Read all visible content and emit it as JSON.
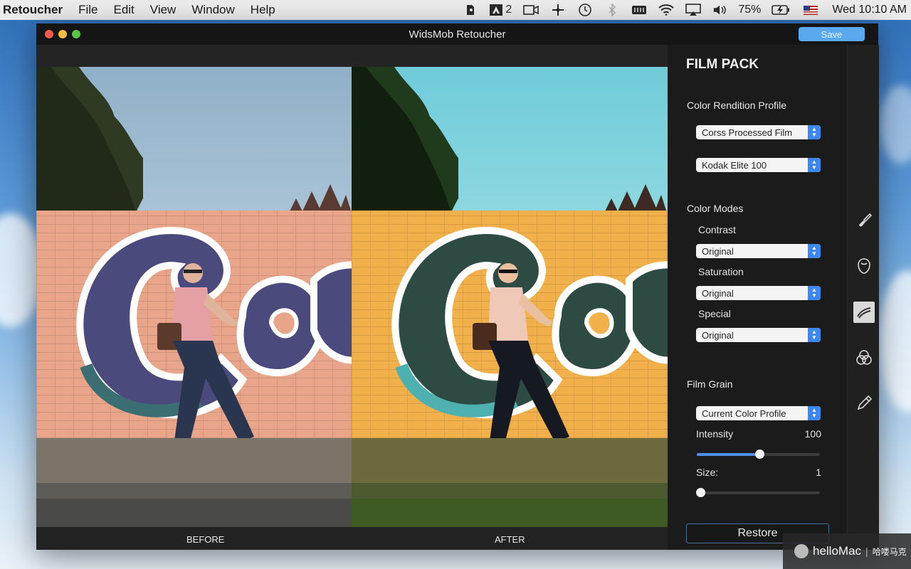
{
  "menubar": {
    "app_name": "Retoucher",
    "items": [
      "File",
      "Edit",
      "View",
      "Window",
      "Help"
    ],
    "adobe_count": "2",
    "battery": "75%",
    "clock": "Wed 10:10 AM",
    "icons": [
      "evernote-icon",
      "adobe-icon",
      "camera-icon",
      "scissors-icon",
      "time-machine-icon",
      "bluetooth-icon",
      "memory-icon",
      "wifi-icon",
      "airplay-icon",
      "volume-icon",
      "battery-icon",
      "flag-icon"
    ]
  },
  "window": {
    "title": "WidsMob Retoucher",
    "save_label": "Save"
  },
  "canvas": {
    "before_label": "BEFORE",
    "after_label": "AFTER"
  },
  "panel": {
    "title": "FILM PACK",
    "color_rendition": {
      "label": "Color Rendition Profile",
      "select1": "Corss Processed Film",
      "select2": "Kodak Elite 100"
    },
    "color_modes": {
      "label": "Color Modes",
      "contrast_label": "Contrast",
      "contrast_value": "Original",
      "saturation_label": "Saturation",
      "saturation_value": "Original",
      "special_label": "Special",
      "special_value": "Original"
    },
    "film_grain": {
      "label": "Film Grain",
      "profile": "Current Color Profile",
      "intensity_label": "Intensity",
      "intensity_value": "100",
      "intensity_fraction": 0.51,
      "size_label": "Size:",
      "size_value": "1",
      "size_fraction": 0.03
    },
    "restore_label": "Restore"
  },
  "toolbar": {
    "tools": [
      "brush-icon",
      "face-icon",
      "film-icon",
      "color-circles-icon",
      "pencil-icon"
    ],
    "active": "film-icon"
  },
  "watermark": {
    "brand": "helloMac",
    "separator": "|",
    "cn": "哈喽马克"
  },
  "colors": {
    "accent": "#5aa9ef",
    "select_arrow": "#3b88f0"
  }
}
